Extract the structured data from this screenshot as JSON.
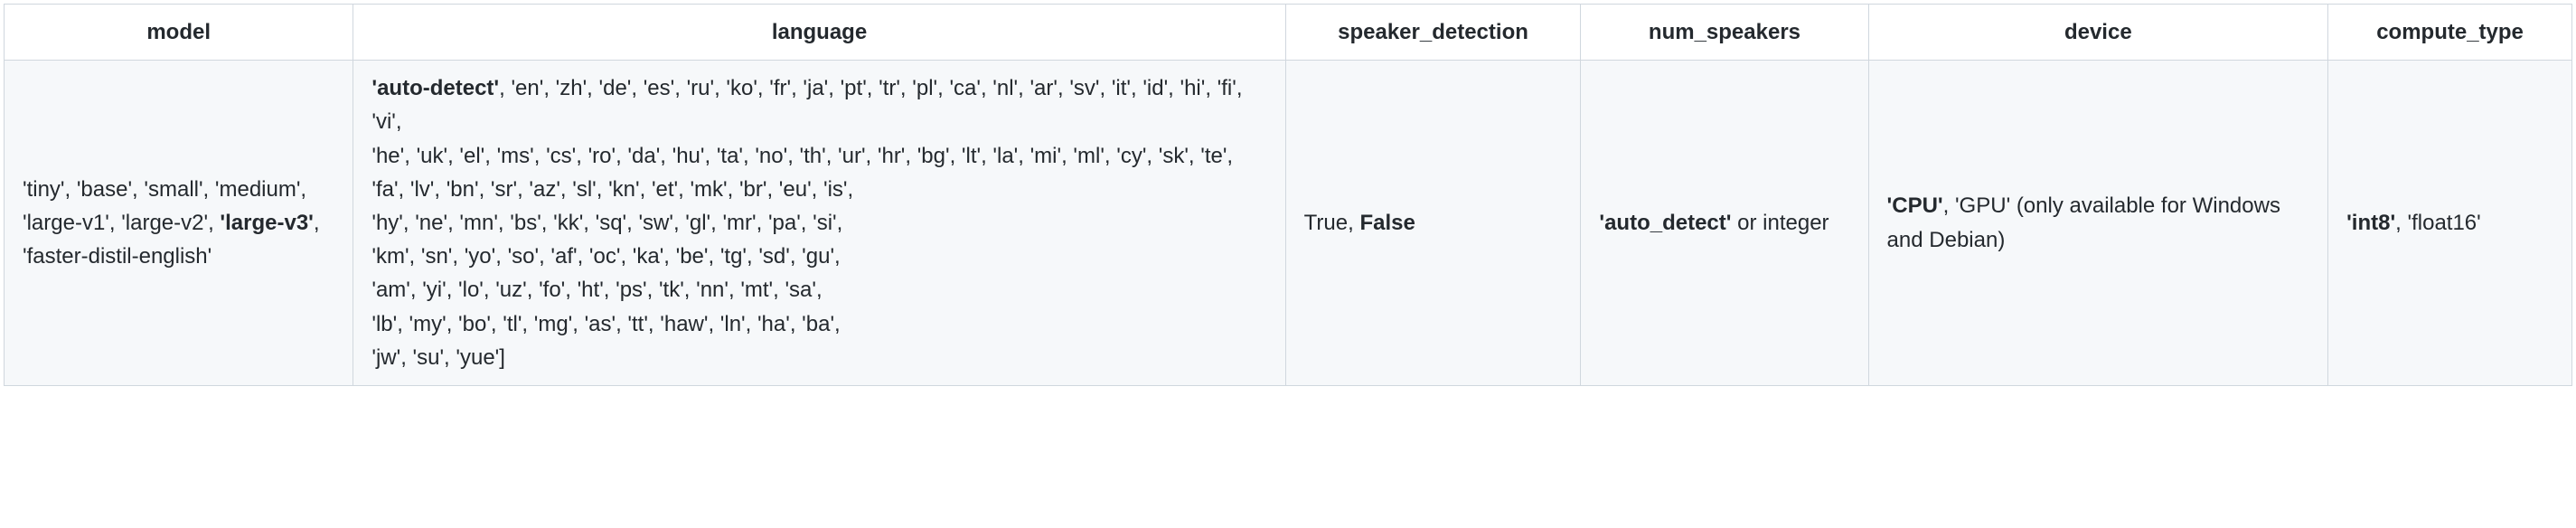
{
  "headers": {
    "model": "model",
    "language": "language",
    "speaker_detection": "speaker_detection",
    "num_speakers": "num_speakers",
    "device": "device",
    "compute_type": "compute_type"
  },
  "row": {
    "model": {
      "prefix": "'tiny', 'base', 'small', 'medium', 'large-v1', 'large-v2', ",
      "bold": "'large-v3'",
      "suffix": ", 'faster-distil-english'"
    },
    "language": {
      "line1_bold": "'auto-detect'",
      "line1_rest": ", 'en', 'zh', 'de', 'es', 'ru', 'ko', 'fr', 'ja', 'pt', 'tr', 'pl', 'ca', 'nl', 'ar', 'sv', 'it', 'id', 'hi', 'fi', 'vi',",
      "line2": "'he', 'uk', 'el', 'ms', 'cs', 'ro', 'da', 'hu', 'ta', 'no', 'th', 'ur', 'hr', 'bg', 'lt', 'la', 'mi', 'ml', 'cy', 'sk', 'te', 'fa', 'lv', 'bn', 'sr', 'az', 'sl', 'kn', 'et', 'mk', 'br', 'eu', 'is',",
      "line3": "'hy', 'ne', 'mn', 'bs', 'kk', 'sq', 'sw', 'gl', 'mr', 'pa', 'si',",
      "line4": "'km', 'sn', 'yo', 'so', 'af', 'oc', 'ka', 'be', 'tg', 'sd', 'gu',",
      "line5": "'am', 'yi', 'lo', 'uz', 'fo', 'ht', 'ps', 'tk', 'nn', 'mt', 'sa',",
      "line6": "'lb', 'my', 'bo', 'tl', 'mg', 'as', 'tt', 'haw', 'ln', 'ha', 'ba',",
      "line7": "'jw', 'su', 'yue']"
    },
    "speaker_detection": {
      "plain": "True, ",
      "bold": "False"
    },
    "num_speakers": {
      "bold": "'auto_detect'",
      "suffix": " or integer"
    },
    "device": {
      "bold": "'CPU'",
      "suffix": ", 'GPU' (only available for Windows and Debian)"
    },
    "compute_type": {
      "bold": "'int8'",
      "suffix": ", 'float16'"
    }
  }
}
